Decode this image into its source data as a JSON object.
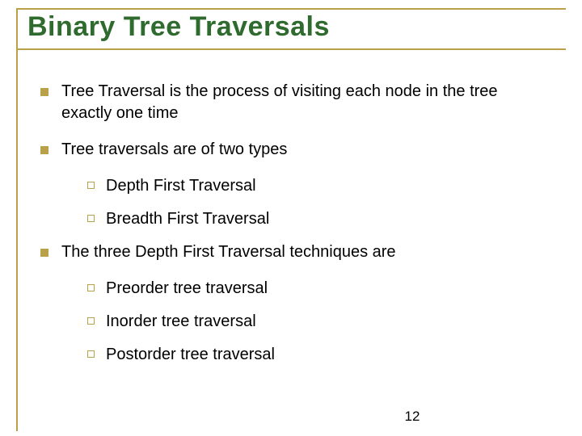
{
  "title": "Binary Tree Traversals",
  "points": [
    {
      "text": "Tree Traversal is the process of visiting each node in the tree exactly one time",
      "sub": []
    },
    {
      "text": "Tree traversals are of two types",
      "sub": [
        "Depth First Traversal",
        "Breadth First Traversal"
      ]
    },
    {
      "text": "The three Depth First Traversal techniques are",
      "sub": [
        "Preorder tree traversal",
        "Inorder tree traversal",
        "Postorder tree traversal"
      ]
    }
  ],
  "page_number": "12"
}
